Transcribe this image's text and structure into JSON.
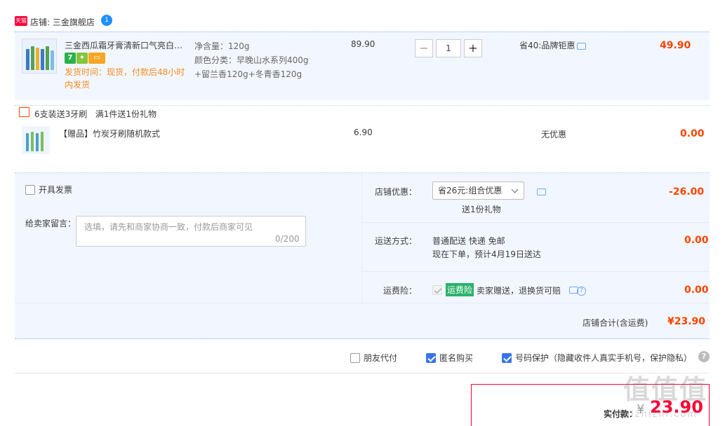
{
  "shop": {
    "logo_text": "天猫",
    "name": "店铺: 三金旗舰店",
    "ww_badge": "1"
  },
  "item": {
    "title": "三金西瓜霜牙膏清新口气亮白护龈牙膏",
    "badge1": "7",
    "ship_time": "发货时间：现货，付款后48小时内发货",
    "spec_weight": "净含量：120g",
    "spec_color_1": "颜色分类：早晚山水系列400g",
    "spec_color_2": "+留兰香120g+冬青香120g",
    "price": "89.90",
    "quantity": "1",
    "discount": "省40:品牌钜惠",
    "subtotal": "49.90"
  },
  "gift": {
    "promo": "6支装送3牙刷   满1件送1份礼物",
    "title": "【赠品】竹炭牙刷随机款式",
    "price": "6.90",
    "discount": "无优惠",
    "subtotal": "0.00"
  },
  "options": {
    "invoice_label": "开具发票",
    "msg_label": "给卖家留言：",
    "msg_placeholder": "选填，请先和商家协商一致，付款后商家可见",
    "msg_count": "0/200",
    "store_disc_label": "店铺优惠：",
    "store_disc_value": "省26元:组合优惠",
    "gift_note": "送1份礼物",
    "store_disc_amount": "-26.00",
    "ship_label": "运送方式：",
    "ship_line1": "普通配送 快递 免邮",
    "ship_line2": "现在下单，预计4月19日送达",
    "ship_amount": "0.00",
    "ins_label": "运费险：",
    "ins_tag": "运费险",
    "ins_text": "卖家赠送，退换货可赔",
    "ins_amount": "0.00",
    "total_label": "店铺合计(含运费)",
    "total_value": "¥23.90"
  },
  "bottom": {
    "friend_pay": "朋友代付",
    "anonymous": "匿名购买",
    "number_protect": "号码保护（隐藏收件人真实手机号，保护隐私）",
    "help": "?"
  },
  "pay": {
    "label": "实付款：",
    "yen": "¥",
    "value": "23.90"
  },
  "watermark": {
    "main": "值值值",
    "sub": "zhizhizhi.com"
  },
  "colors": {
    "accent_red": "#ff0036",
    "price_red": "#ff4400",
    "panel_blue": "#f2f7ff",
    "checkbox_blue": "#3a74e8",
    "ins_green": "#2ab36a"
  }
}
